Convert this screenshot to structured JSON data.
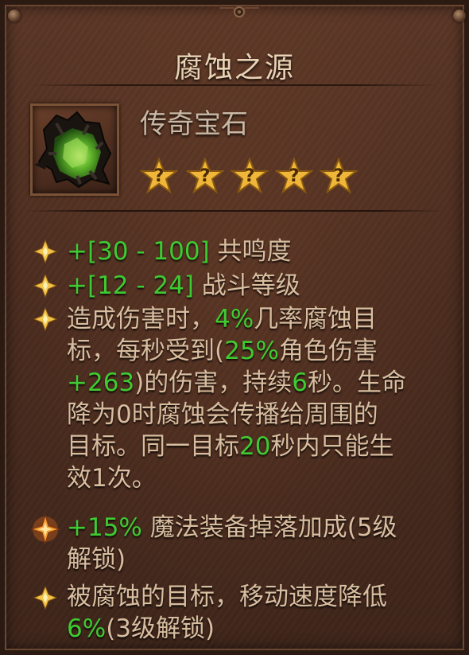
{
  "item": {
    "name": "腐蚀之源",
    "rarity": "传奇宝石",
    "star_count": 5,
    "star_glyph": "?",
    "icon": "legendary-gem-icon"
  },
  "affixes": [
    {
      "parts": [
        "+[30 - 100] 共鸣度"
      ],
      "green_index": [],
      "bullet": "gold-diamond-icon"
    },
    {
      "parts": [
        "+[12 - 24] 战斗等级"
      ],
      "green_index": [],
      "bullet": "gold-diamond-icon"
    }
  ],
  "affix1": {
    "green": "+[30 - 100]",
    "text": " 共鸣度"
  },
  "affix2": {
    "green": "+[12 - 24]",
    "text": " 战斗等级"
  },
  "affix3": {
    "l1a": "造成伤害时，",
    "l1g": "4%",
    "l1b": "几率腐蚀目",
    "l2a": "标，每秒受到(",
    "l2g": "25%",
    "l2b": "角色伤害",
    "l3g": "+263",
    "l3a": ")的伤害，持续",
    "l3g2": "6",
    "l3b": "秒。生命",
    "l4": "降为0时腐蚀会传播给周围的",
    "l5a": "目标。同一目标",
    "l5g": "20",
    "l5b": "秒内只能生",
    "l6": "效1次。"
  },
  "affix4": {
    "l1g": "+15%",
    "l1a": " 魔法装备掉落加成(5级",
    "l2": "解锁)"
  },
  "affix5": {
    "l1": "被腐蚀的目标，移动速度降低",
    "l2g": "6%",
    "l2a": "(3级解锁)"
  },
  "colors": {
    "text": "#d8bea0",
    "highlight": "#3ecb32",
    "title": "#e9d3b4",
    "rarity": "#c9b8a4",
    "star": "#f0b63a"
  }
}
